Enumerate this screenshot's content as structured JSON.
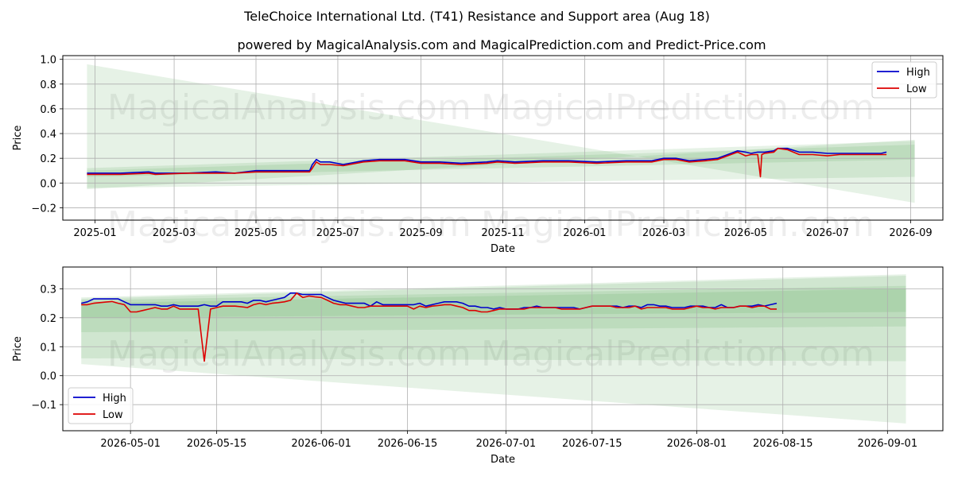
{
  "title": "TeleChoice International Ltd. (T41) Resistance and Support area (Aug 18)",
  "subtitle": "powered by MagicalAnalysis.com and MagicalPrediction.com and Predict-Price.com",
  "watermarks": [
    "MagicalAnalysis.com",
    "MagicalPrediction.com"
  ],
  "colors": {
    "high": "#0000cc",
    "low": "#dd0000",
    "band": "#3a9a3a",
    "grid": "#b0b0b0"
  },
  "chart_data": [
    {
      "type": "line",
      "xlabel": "Date",
      "ylabel": "Price",
      "xlim": [
        "2024-12-08",
        "2026-09-25"
      ],
      "ylim": [
        -0.3,
        1.03
      ],
      "grid": true,
      "legend_position": "top-right",
      "xticks": [
        "2025-01",
        "2025-03",
        "2025-05",
        "2025-07",
        "2025-09",
        "2025-11",
        "2026-01",
        "2026-03",
        "2026-05",
        "2026-07",
        "2026-09"
      ],
      "yticks": [
        "−0.2",
        "0.0",
        "0.2",
        "0.4",
        "0.6",
        "0.8",
        "1.0"
      ],
      "series": [
        {
          "name": "High",
          "x": [
            "2024-12-26",
            "2025-01-20",
            "2025-02-10",
            "2025-02-15",
            "2025-03-10",
            "2025-04-01",
            "2025-04-15",
            "2025-05-01",
            "2025-05-20",
            "2025-06-10",
            "2025-06-12",
            "2025-06-15",
            "2025-06-18",
            "2025-06-25",
            "2025-07-05",
            "2025-07-20",
            "2025-08-01",
            "2025-08-20",
            "2025-09-01",
            "2025-09-15",
            "2025-10-01",
            "2025-10-20",
            "2025-10-28",
            "2025-11-10",
            "2025-12-01",
            "2025-12-20",
            "2026-01-10",
            "2026-02-01",
            "2026-02-20",
            "2026-03-01",
            "2026-03-10",
            "2026-03-20",
            "2026-04-01",
            "2026-04-10",
            "2026-04-20",
            "2026-04-25",
            "2026-05-01",
            "2026-05-05",
            "2026-05-10",
            "2026-05-15",
            "2026-05-22",
            "2026-05-25",
            "2026-06-01",
            "2026-06-10",
            "2026-06-20",
            "2026-07-01",
            "2026-07-10",
            "2026-07-20",
            "2026-08-01",
            "2026-08-10",
            "2026-08-14"
          ],
          "values": [
            0.08,
            0.08,
            0.09,
            0.08,
            0.08,
            0.09,
            0.08,
            0.1,
            0.1,
            0.1,
            0.15,
            0.19,
            0.17,
            0.17,
            0.15,
            0.18,
            0.19,
            0.19,
            0.17,
            0.17,
            0.16,
            0.17,
            0.18,
            0.17,
            0.18,
            0.18,
            0.17,
            0.18,
            0.18,
            0.2,
            0.2,
            0.18,
            0.19,
            0.2,
            0.24,
            0.26,
            0.25,
            0.24,
            0.25,
            0.25,
            0.26,
            0.28,
            0.28,
            0.25,
            0.25,
            0.24,
            0.24,
            0.24,
            0.24,
            0.24,
            0.25
          ]
        },
        {
          "name": "Low",
          "x": [
            "2024-12-26",
            "2025-01-20",
            "2025-02-10",
            "2025-02-15",
            "2025-03-10",
            "2025-04-01",
            "2025-04-15",
            "2025-05-01",
            "2025-05-20",
            "2025-06-10",
            "2025-06-12",
            "2025-06-15",
            "2025-06-18",
            "2025-06-25",
            "2025-07-05",
            "2025-07-20",
            "2025-08-01",
            "2025-08-20",
            "2025-09-01",
            "2025-09-15",
            "2025-10-01",
            "2025-10-20",
            "2025-10-28",
            "2025-11-10",
            "2025-12-01",
            "2025-12-20",
            "2026-01-10",
            "2026-02-01",
            "2026-02-20",
            "2026-03-01",
            "2026-03-10",
            "2026-03-20",
            "2026-04-01",
            "2026-04-10",
            "2026-04-20",
            "2026-04-25",
            "2026-05-01",
            "2026-05-05",
            "2026-05-10",
            "2026-05-12",
            "2026-05-13",
            "2026-05-15",
            "2026-05-22",
            "2026-05-25",
            "2026-06-01",
            "2026-06-10",
            "2026-06-20",
            "2026-07-01",
            "2026-07-10",
            "2026-07-20",
            "2026-08-01",
            "2026-08-10",
            "2026-08-14"
          ],
          "values": [
            0.07,
            0.07,
            0.08,
            0.07,
            0.08,
            0.08,
            0.08,
            0.09,
            0.09,
            0.09,
            0.12,
            0.17,
            0.15,
            0.15,
            0.14,
            0.17,
            0.18,
            0.18,
            0.16,
            0.16,
            0.15,
            0.16,
            0.17,
            0.16,
            0.17,
            0.17,
            0.16,
            0.17,
            0.17,
            0.19,
            0.19,
            0.17,
            0.18,
            0.19,
            0.23,
            0.25,
            0.22,
            0.23,
            0.23,
            0.05,
            0.23,
            0.24,
            0.25,
            0.28,
            0.27,
            0.23,
            0.23,
            0.22,
            0.23,
            0.23,
            0.23,
            0.23,
            0.23
          ]
        }
      ],
      "bands": [
        {
          "x": [
            "2024-12-26",
            "2026-09-04"
          ],
          "upper": [
            0.96,
            -0.16
          ],
          "lower": [
            -0.05,
            0.35
          ]
        },
        {
          "x": [
            "2024-12-26",
            "2026-09-04"
          ],
          "upper": [
            0.12,
            0.34
          ],
          "lower": [
            -0.04,
            0.05
          ]
        },
        {
          "x": [
            "2024-12-26",
            "2026-09-04"
          ],
          "upper": [
            0.1,
            0.31
          ],
          "lower": [
            0.05,
            0.19
          ]
        }
      ]
    },
    {
      "type": "line",
      "xlabel": "Date",
      "ylabel": "Price",
      "xlim": [
        "2026-04-20",
        "2026-09-10"
      ],
      "ylim": [
        -0.19,
        0.375
      ],
      "grid": true,
      "legend_position": "bottom-left",
      "xticks": [
        "2026-05-01",
        "2026-05-15",
        "2026-06-01",
        "2026-06-15",
        "2026-07-01",
        "2026-07-15",
        "2026-08-01",
        "2026-08-15",
        "2026-09-01"
      ],
      "yticks": [
        "−0.1",
        "0.0",
        "0.1",
        "0.2",
        "0.3"
      ],
      "series": [
        {
          "name": "High",
          "x": [
            "2026-04-23",
            "2026-04-24",
            "2026-04-25",
            "2026-04-26",
            "2026-04-27",
            "2026-04-28",
            "2026-04-29",
            "2026-04-30",
            "2026-05-01",
            "2026-05-02",
            "2026-05-03",
            "2026-05-04",
            "2026-05-05",
            "2026-05-06",
            "2026-05-07",
            "2026-05-08",
            "2026-05-09",
            "2026-05-10",
            "2026-05-11",
            "2026-05-12",
            "2026-05-13",
            "2026-05-14",
            "2026-05-15",
            "2026-05-16",
            "2026-05-17",
            "2026-05-18",
            "2026-05-19",
            "2026-05-20",
            "2026-05-21",
            "2026-05-22",
            "2026-05-23",
            "2026-05-24",
            "2026-05-25",
            "2026-05-26",
            "2026-05-27",
            "2026-05-28",
            "2026-05-29",
            "2026-05-30",
            "2026-05-31",
            "2026-06-01",
            "2026-06-02",
            "2026-06-03",
            "2026-06-04",
            "2026-06-05",
            "2026-06-06",
            "2026-06-07",
            "2026-06-08",
            "2026-06-09",
            "2026-06-10",
            "2026-06-11",
            "2026-06-12",
            "2026-06-13",
            "2026-06-14",
            "2026-06-15",
            "2026-06-16",
            "2026-06-17",
            "2026-06-18",
            "2026-06-19",
            "2026-06-20",
            "2026-06-21",
            "2026-06-22",
            "2026-06-23",
            "2026-06-24",
            "2026-06-25",
            "2026-06-26",
            "2026-06-27",
            "2026-06-28",
            "2026-06-29",
            "2026-06-30",
            "2026-07-01",
            "2026-07-02",
            "2026-07-03",
            "2026-07-04",
            "2026-07-05",
            "2026-07-06",
            "2026-07-07",
            "2026-07-08",
            "2026-07-09",
            "2026-07-10",
            "2026-07-11",
            "2026-07-12",
            "2026-07-13",
            "2026-07-14",
            "2026-07-15",
            "2026-07-16",
            "2026-07-17",
            "2026-07-18",
            "2026-07-19",
            "2026-07-20",
            "2026-07-21",
            "2026-07-22",
            "2026-07-23",
            "2026-07-24",
            "2026-07-25",
            "2026-07-26",
            "2026-07-27",
            "2026-07-28",
            "2026-07-29",
            "2026-07-30",
            "2026-07-31",
            "2026-08-01",
            "2026-08-02",
            "2026-08-03",
            "2026-08-04",
            "2026-08-05",
            "2026-08-06",
            "2026-08-07",
            "2026-08-08",
            "2026-08-09",
            "2026-08-10",
            "2026-08-11",
            "2026-08-12",
            "2026-08-13",
            "2026-08-14"
          ],
          "values": [
            0.25,
            0.255,
            0.265,
            0.265,
            0.265,
            0.265,
            0.265,
            0.255,
            0.245,
            0.245,
            0.245,
            0.245,
            0.245,
            0.24,
            0.24,
            0.245,
            0.24,
            0.24,
            0.24,
            0.24,
            0.245,
            0.24,
            0.24,
            0.255,
            0.255,
            0.255,
            0.255,
            0.25,
            0.26,
            0.26,
            0.255,
            0.26,
            0.265,
            0.27,
            0.285,
            0.285,
            0.28,
            0.28,
            0.28,
            0.28,
            0.27,
            0.26,
            0.255,
            0.25,
            0.25,
            0.25,
            0.25,
            0.24,
            0.255,
            0.245,
            0.245,
            0.245,
            0.245,
            0.245,
            0.245,
            0.25,
            0.24,
            0.245,
            0.25,
            0.255,
            0.255,
            0.255,
            0.25,
            0.24,
            0.24,
            0.235,
            0.235,
            0.23,
            0.235,
            0.23,
            0.23,
            0.23,
            0.235,
            0.235,
            0.24,
            0.235,
            0.235,
            0.235,
            0.235,
            0.235,
            0.235,
            0.23,
            0.235,
            0.24,
            0.24,
            0.24,
            0.24,
            0.24,
            0.235,
            0.24,
            0.24,
            0.235,
            0.245,
            0.245,
            0.24,
            0.24,
            0.235,
            0.235,
            0.235,
            0.24,
            0.24,
            0.24,
            0.235,
            0.235,
            0.245,
            0.235,
            0.235,
            0.24,
            0.24,
            0.24,
            0.245,
            0.24,
            0.245,
            0.25
          ]
        },
        {
          "name": "Low",
          "x": [
            "2026-04-23",
            "2026-04-24",
            "2026-04-25",
            "2026-04-26",
            "2026-04-27",
            "2026-04-28",
            "2026-04-29",
            "2026-04-30",
            "2026-05-01",
            "2026-05-02",
            "2026-05-03",
            "2026-05-04",
            "2026-05-05",
            "2026-05-06",
            "2026-05-07",
            "2026-05-08",
            "2026-05-09",
            "2026-05-10",
            "2026-05-11",
            "2026-05-12",
            "2026-05-13",
            "2026-05-14",
            "2026-05-15",
            "2026-05-16",
            "2026-05-17",
            "2026-05-18",
            "2026-05-19",
            "2026-05-20",
            "2026-05-21",
            "2026-05-22",
            "2026-05-23",
            "2026-05-24",
            "2026-05-25",
            "2026-05-26",
            "2026-05-27",
            "2026-05-28",
            "2026-05-29",
            "2026-05-30",
            "2026-05-31",
            "2026-06-01",
            "2026-06-02",
            "2026-06-03",
            "2026-06-04",
            "2026-06-05",
            "2026-06-06",
            "2026-06-07",
            "2026-06-08",
            "2026-06-09",
            "2026-06-10",
            "2026-06-11",
            "2026-06-12",
            "2026-06-13",
            "2026-06-14",
            "2026-06-15",
            "2026-06-16",
            "2026-06-17",
            "2026-06-18",
            "2026-06-19",
            "2026-06-20",
            "2026-06-21",
            "2026-06-22",
            "2026-06-23",
            "2026-06-24",
            "2026-06-25",
            "2026-06-26",
            "2026-06-27",
            "2026-06-28",
            "2026-06-29",
            "2026-06-30",
            "2026-07-01",
            "2026-07-02",
            "2026-07-03",
            "2026-07-04",
            "2026-07-05",
            "2026-07-06",
            "2026-07-07",
            "2026-07-08",
            "2026-07-09",
            "2026-07-10",
            "2026-07-11",
            "2026-07-12",
            "2026-07-13",
            "2026-07-14",
            "2026-07-15",
            "2026-07-16",
            "2026-07-17",
            "2026-07-18",
            "2026-07-19",
            "2026-07-20",
            "2026-07-21",
            "2026-07-22",
            "2026-07-23",
            "2026-07-24",
            "2026-07-25",
            "2026-07-26",
            "2026-07-27",
            "2026-07-28",
            "2026-07-29",
            "2026-07-30",
            "2026-07-31",
            "2026-08-01",
            "2026-08-02",
            "2026-08-03",
            "2026-08-04",
            "2026-08-05",
            "2026-08-06",
            "2026-08-07",
            "2026-08-08",
            "2026-08-09",
            "2026-08-10",
            "2026-08-11",
            "2026-08-12",
            "2026-08-13",
            "2026-08-14"
          ],
          "values": [
            0.245,
            0.245,
            0.25,
            0.252,
            0.254,
            0.256,
            0.25,
            0.245,
            0.22,
            0.22,
            0.225,
            0.23,
            0.235,
            0.23,
            0.23,
            0.24,
            0.23,
            0.23,
            0.23,
            0.23,
            0.05,
            0.23,
            0.235,
            0.24,
            0.24,
            0.24,
            0.238,
            0.235,
            0.245,
            0.25,
            0.245,
            0.25,
            0.252,
            0.255,
            0.26,
            0.285,
            0.27,
            0.275,
            0.272,
            0.27,
            0.26,
            0.25,
            0.245,
            0.245,
            0.24,
            0.235,
            0.235,
            0.24,
            0.24,
            0.24,
            0.24,
            0.24,
            0.24,
            0.24,
            0.23,
            0.24,
            0.235,
            0.24,
            0.242,
            0.245,
            0.245,
            0.24,
            0.235,
            0.225,
            0.225,
            0.22,
            0.22,
            0.225,
            0.23,
            0.23,
            0.23,
            0.23,
            0.23,
            0.235,
            0.235,
            0.235,
            0.235,
            0.235,
            0.23,
            0.23,
            0.23,
            0.23,
            0.235,
            0.24,
            0.24,
            0.24,
            0.24,
            0.235,
            0.235,
            0.235,
            0.24,
            0.23,
            0.235,
            0.235,
            0.235,
            0.235,
            0.23,
            0.23,
            0.23,
            0.235,
            0.24,
            0.235,
            0.235,
            0.23,
            0.235,
            0.235,
            0.235,
            0.24,
            0.24,
            0.235,
            0.24,
            0.24,
            0.23,
            0.23
          ]
        }
      ],
      "bands": [
        {
          "x": [
            "2026-04-23",
            "2026-09-04"
          ],
          "upper": [
            0.27,
            0.35
          ],
          "lower": [
            0.04,
            -0.165
          ]
        },
        {
          "x": [
            "2026-04-23",
            "2026-09-04"
          ],
          "upper": [
            0.265,
            0.345
          ],
          "lower": [
            0.06,
            0.05
          ]
        },
        {
          "x": [
            "2026-04-23",
            "2026-09-04"
          ],
          "upper": [
            0.26,
            0.31
          ],
          "lower": [
            0.15,
            0.17
          ]
        },
        {
          "x": [
            "2026-04-23",
            "2026-09-04"
          ],
          "upper": [
            0.25,
            0.3
          ],
          "lower": [
            0.2,
            0.22
          ]
        }
      ]
    }
  ]
}
